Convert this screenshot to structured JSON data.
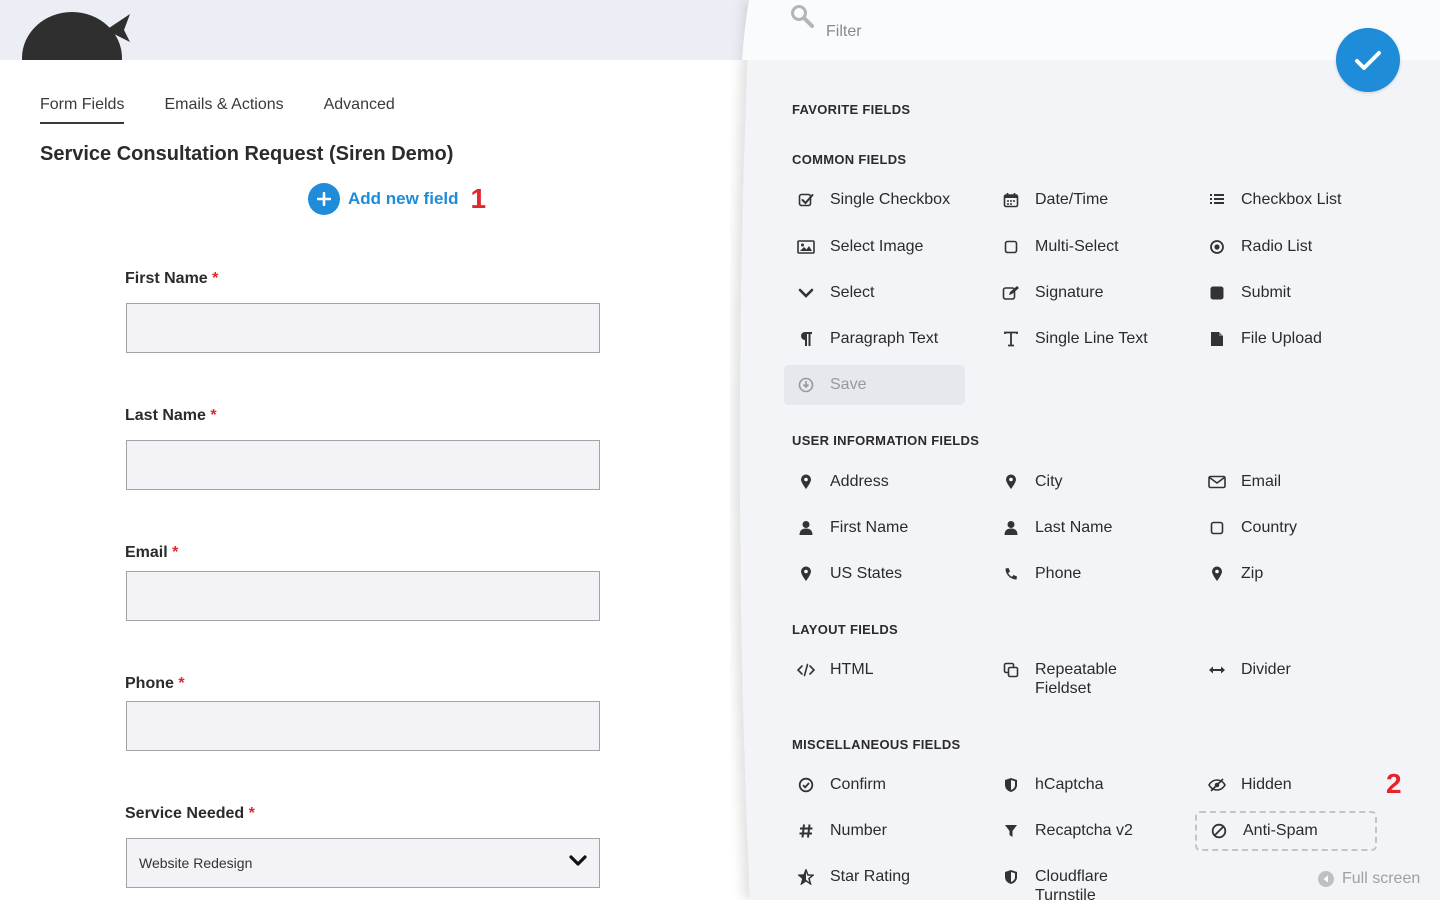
{
  "tabs": [
    {
      "label": "Form Fields"
    },
    {
      "label": "Emails & Actions"
    },
    {
      "label": "Advanced"
    }
  ],
  "form": {
    "title": "Service Consultation Request (Siren Demo)",
    "add_field_label": "Add new field",
    "marker_1": "1",
    "required_mark": "*",
    "fields": [
      {
        "label": "First Name"
      },
      {
        "label": "Last Name"
      },
      {
        "label": "Email"
      },
      {
        "label": "Phone"
      },
      {
        "label": "Service Needed",
        "value": "Website Redesign"
      }
    ]
  },
  "drawer": {
    "filter_placeholder": "Filter",
    "marker_2": "2",
    "fullscreen_label": "Full screen",
    "sections": {
      "favorite": "FAVORITE FIELDS",
      "common": "COMMON FIELDS",
      "user_info": "USER INFORMATION FIELDS",
      "layout": "LAYOUT FIELDS",
      "misc": "MISCELLANEOUS FIELDS"
    },
    "common": {
      "single_checkbox": "Single Checkbox",
      "datetime": "Date/Time",
      "checkbox_list": "Checkbox List",
      "select_image": "Select Image",
      "multi_select": "Multi-Select",
      "radio_list": "Radio List",
      "select": "Select",
      "signature": "Signature",
      "submit": "Submit",
      "paragraph_text": "Paragraph Text",
      "single_line_text": "Single Line Text",
      "file_upload": "File Upload",
      "save": "Save"
    },
    "user_info": {
      "address": "Address",
      "city": "City",
      "email": "Email",
      "first_name": "First Name",
      "last_name": "Last Name",
      "country": "Country",
      "us_states": "US States",
      "phone": "Phone",
      "zip": "Zip"
    },
    "layout": {
      "html": "HTML",
      "repeatable_fieldset": "Repeatable Fieldset",
      "divider": "Divider"
    },
    "misc": {
      "confirm": "Confirm",
      "hcaptcha": "hCaptcha",
      "hidden": "Hidden",
      "number": "Number",
      "recaptcha": "Recaptcha v2",
      "anti_spam": "Anti-Spam",
      "star_rating": "Star Rating",
      "turnstile": "Cloudflare Turnstile"
    }
  },
  "colors": {
    "accent": "#1e8cd9",
    "required": "#e2262b",
    "topbar": "#eceef6",
    "drawer": "#f3f4f8"
  }
}
